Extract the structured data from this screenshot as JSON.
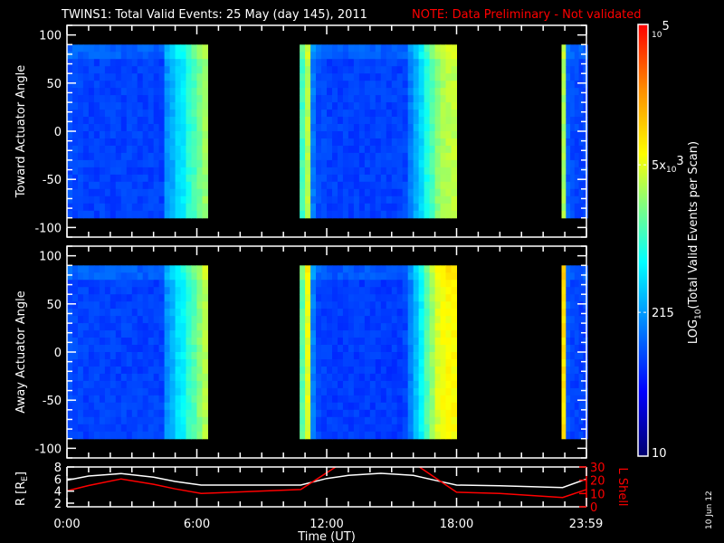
{
  "chart_data": {
    "type": "heatmap",
    "title": "TWINS1: Total Valid Events: 25 May (day 145), 2011",
    "note": "NOTE: Data Preliminary - Not validated",
    "xlabel": "Time (UT)",
    "xlim": [
      0,
      24
    ],
    "x_tick_labels": [
      {
        "value": 0,
        "label": "0:00"
      },
      {
        "value": 6,
        "label": "6:00"
      },
      {
        "value": 12,
        "label": "12:00"
      },
      {
        "value": 18,
        "label": "18:00"
      },
      {
        "value": 23.98,
        "label": "23:59"
      }
    ],
    "colorbar": {
      "title_prefix": "LOG",
      "title_sub": "10",
      "title_suffix": "(Total Valid Events per Scan)",
      "scale": "log",
      "range": [
        10,
        100000
      ],
      "ticks": [
        {
          "value": 100000,
          "base": "10",
          "exp": "5",
          "prefix": ""
        },
        {
          "value": 5000,
          "base": "10",
          "exp": "3",
          "prefix": "5x"
        },
        {
          "value": 215,
          "label": "215"
        },
        {
          "value": 10,
          "label": "10"
        }
      ]
    },
    "panels": [
      {
        "ylabel": "Toward Actuator Angle",
        "ylim": [
          -110,
          110
        ],
        "yticks": [
          100,
          50,
          0,
          -50,
          -100
        ],
        "angle_range": [
          -90,
          90
        ],
        "segments": [
          {
            "start": 0,
            "step": 0.25,
            "values": [
              90,
              85,
              85,
              80,
              80,
              80,
              80,
              80,
              80,
              80,
              80,
              80,
              80,
              80,
              80,
              80,
              80,
              80,
              200,
              260,
              420,
              520,
              900,
              1200,
              1800,
              2600
            ]
          },
          {
            "start": 10.75,
            "step": 0.25,
            "values": [
              1200,
              3200,
              150,
              90,
              85,
              80,
              80,
              80,
              80,
              80,
              80,
              80,
              80,
              80,
              80,
              80,
              80,
              80,
              80,
              85,
              150,
              260,
              420,
              800,
              1300,
              2200,
              3000,
              3400,
              3600
            ]
          },
          {
            "start": 22.85,
            "step": 0.2,
            "values": [
              3000,
              110,
              90,
              85,
              85,
              85
            ]
          }
        ]
      },
      {
        "ylabel": "Away Actuator Angle",
        "ylim": [
          -110,
          110
        ],
        "yticks": [
          100,
          50,
          0,
          -50,
          -100
        ],
        "angle_range": [
          -90,
          90
        ],
        "segments": [
          {
            "start": 0,
            "step": 0.25,
            "values": [
              90,
              85,
              85,
              80,
              80,
              80,
              80,
              80,
              80,
              80,
              80,
              80,
              80,
              80,
              80,
              80,
              80,
              80,
              200,
              280,
              450,
              600,
              1000,
              1400,
              2200,
              3200
            ]
          },
          {
            "start": 10.75,
            "step": 0.25,
            "values": [
              1500,
              5000,
              160,
              85,
              80,
              75,
              75,
              75,
              75,
              75,
              75,
              75,
              75,
              75,
              75,
              75,
              75,
              75,
              75,
              85,
              160,
              300,
              600,
              1300,
              2600,
              4500,
              6000,
              6500,
              6500
            ]
          },
          {
            "start": 22.85,
            "step": 0.2,
            "values": [
              9000,
              100,
              85,
              80,
              80,
              80
            ]
          }
        ]
      }
    ],
    "orbit": {
      "left_label": "R [R",
      "left_label_sub": "E",
      "left_label_end": "]",
      "right_label": "L Shell",
      "r_ylim": [
        1.4,
        8
      ],
      "r_ticks": [
        8,
        6,
        4,
        2
      ],
      "l_ylim": [
        0,
        30
      ],
      "l_ticks": [
        30,
        20,
        10,
        0
      ],
      "R_series": [
        [
          0,
          5.8
        ],
        [
          1,
          6.5
        ],
        [
          2.5,
          6.9
        ],
        [
          4,
          6.3
        ],
        [
          5,
          5.6
        ],
        [
          6.2,
          5.0
        ],
        [
          10.8,
          5.0
        ],
        [
          12,
          6.1
        ],
        [
          13,
          6.6
        ],
        [
          14.5,
          6.95
        ],
        [
          16,
          6.6
        ],
        [
          17,
          5.8
        ],
        [
          18,
          5.0
        ],
        [
          20,
          4.9
        ],
        [
          22.9,
          4.6
        ],
        [
          24,
          6.0
        ]
      ],
      "L_series": [
        [
          0,
          12
        ],
        [
          1,
          16
        ],
        [
          2.5,
          21
        ],
        [
          4,
          17
        ],
        [
          5,
          13.5
        ],
        [
          6.2,
          10
        ],
        [
          10.8,
          13
        ],
        [
          12.6,
          32
        ],
        [
          16.1,
          32
        ],
        [
          18,
          11
        ],
        [
          20,
          10
        ],
        [
          22.9,
          7
        ],
        [
          24,
          13
        ]
      ]
    },
    "date_stamp": "10 Jun 12",
    "colors": {
      "r_line": "#ffffff",
      "l_line": "#ff0000",
      "note": "#ff0000"
    }
  }
}
